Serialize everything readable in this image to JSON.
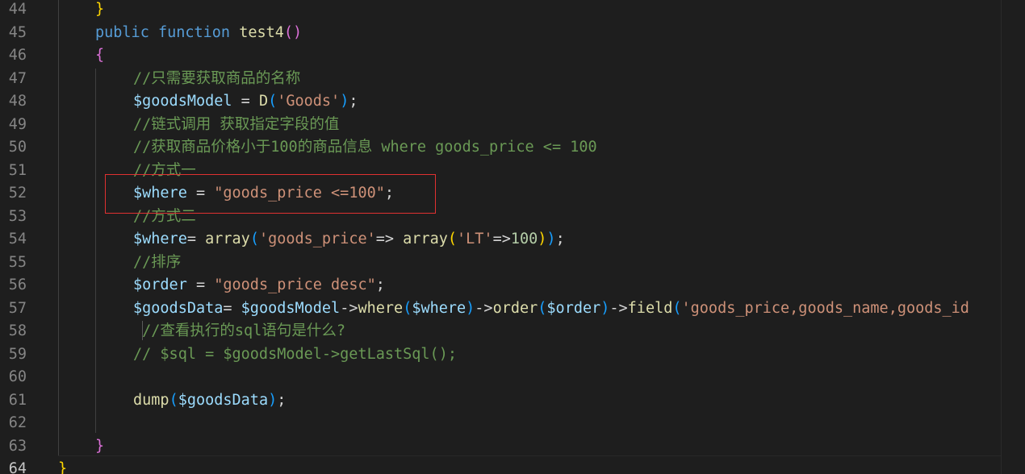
{
  "editor": {
    "lines": [
      {
        "n": "44",
        "tokens": [
          [
            "b-gold",
            "}"
          ]
        ]
      },
      {
        "n": "45",
        "tokens": [
          [
            "c-kw",
            "public "
          ],
          [
            "c-kw",
            "function "
          ],
          [
            "c-fn",
            "test4"
          ],
          [
            "b-purple",
            "()"
          ]
        ]
      },
      {
        "n": "46",
        "tokens": [
          [
            "b-purple",
            "{"
          ]
        ]
      },
      {
        "n": "47",
        "tokens": [
          [
            "c-cmt",
            "//只需要获取商品的名称"
          ]
        ]
      },
      {
        "n": "48",
        "tokens": [
          [
            "c-var",
            "$goodsModel"
          ],
          [
            "c-op",
            " = "
          ],
          [
            "c-fn",
            "D"
          ],
          [
            "b-blue",
            "("
          ],
          [
            "c-str",
            "'Goods'"
          ],
          [
            "b-blue",
            ")"
          ],
          [
            "c-op",
            ";"
          ]
        ]
      },
      {
        "n": "49",
        "tokens": [
          [
            "c-cmt",
            "//链式调用 获取指定字段的值"
          ]
        ]
      },
      {
        "n": "50",
        "tokens": [
          [
            "c-cmt",
            "//获取商品价格小于100的商品信息 where goods_price <= 100"
          ]
        ]
      },
      {
        "n": "51",
        "tokens": [
          [
            "c-cmt",
            "//方式一"
          ]
        ]
      },
      {
        "n": "52",
        "tokens": [
          [
            "c-var",
            "$where"
          ],
          [
            "c-op",
            " = "
          ],
          [
            "c-str",
            "\"goods_price <=100\""
          ],
          [
            "c-op",
            ";"
          ]
        ]
      },
      {
        "n": "53",
        "tokens": [
          [
            "c-cmt",
            "//方式二"
          ]
        ]
      },
      {
        "n": "54",
        "tokens": [
          [
            "c-var",
            "$where"
          ],
          [
            "c-op",
            "= "
          ],
          [
            "c-fn",
            "array"
          ],
          [
            "b-blue",
            "("
          ],
          [
            "c-str",
            "'goods_price'"
          ],
          [
            "c-op",
            "=> "
          ],
          [
            "c-fn",
            "array"
          ],
          [
            "b-gold",
            "("
          ],
          [
            "c-str",
            "'LT'"
          ],
          [
            "c-op",
            "=>"
          ],
          [
            "c-num",
            "100"
          ],
          [
            "b-gold",
            ")"
          ],
          [
            "b-blue",
            ")"
          ],
          [
            "c-op",
            ";"
          ]
        ]
      },
      {
        "n": "55",
        "tokens": [
          [
            "c-cmt",
            "//排序"
          ]
        ]
      },
      {
        "n": "56",
        "tokens": [
          [
            "c-var",
            "$order"
          ],
          [
            "c-op",
            " = "
          ],
          [
            "c-str",
            "\"goods_price desc\""
          ],
          [
            "c-op",
            ";"
          ]
        ]
      },
      {
        "n": "57",
        "tokens": [
          [
            "c-var",
            "$goodsData"
          ],
          [
            "c-op",
            "= "
          ],
          [
            "c-var",
            "$goodsModel"
          ],
          [
            "c-op",
            "->"
          ],
          [
            "c-fn",
            "where"
          ],
          [
            "b-blue",
            "("
          ],
          [
            "c-var",
            "$where"
          ],
          [
            "b-blue",
            ")"
          ],
          [
            "c-op",
            "->"
          ],
          [
            "c-fn",
            "order"
          ],
          [
            "b-blue",
            "("
          ],
          [
            "c-var",
            "$order"
          ],
          [
            "b-blue",
            ")"
          ],
          [
            "c-op",
            "->"
          ],
          [
            "c-fn",
            "field"
          ],
          [
            "b-blue",
            "("
          ],
          [
            "c-str",
            "'goods_price,goods_name,goods_id"
          ]
        ]
      },
      {
        "n": "58",
        "tokens": [
          [
            "c-cmt",
            " //查看执行的sql语句是什么?"
          ]
        ]
      },
      {
        "n": "59",
        "tokens": [
          [
            "c-cmt",
            "// $sql = $goodsModel->getLastSql();"
          ]
        ]
      },
      {
        "n": "60",
        "tokens": []
      },
      {
        "n": "61",
        "tokens": [
          [
            "c-fn",
            "dump"
          ],
          [
            "b-blue",
            "("
          ],
          [
            "c-var",
            "$goodsData"
          ],
          [
            "b-blue",
            ")"
          ],
          [
            "c-op",
            ";"
          ]
        ]
      },
      {
        "n": "62",
        "tokens": []
      },
      {
        "n": "63",
        "tokens": [
          [
            "b-purple",
            "}"
          ]
        ]
      },
      {
        "n": "64",
        "tokens": [
          [
            "b-gold",
            "}"
          ]
        ]
      }
    ]
  }
}
